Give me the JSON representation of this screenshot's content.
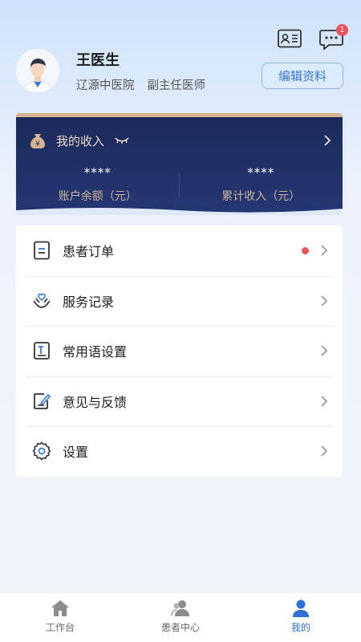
{
  "header": {
    "message_badge": "1"
  },
  "profile": {
    "name": "王医生",
    "hospital": "辽源中医院",
    "title": "副主任医师",
    "edit_label": "编辑资料"
  },
  "income": {
    "title": "我的收入",
    "balance_value": "****",
    "balance_label": "账户余额（元）",
    "total_value": "****",
    "total_label": "累计收入（元）"
  },
  "menu": {
    "items": [
      {
        "label": "患者订单",
        "icon": "document-icon",
        "has_dot": true
      },
      {
        "label": "服务记录",
        "icon": "hands-heart-icon"
      },
      {
        "label": "常用语设置",
        "icon": "text-template-icon"
      },
      {
        "label": "意见与反馈",
        "icon": "feedback-edit-icon"
      },
      {
        "label": "设置",
        "icon": "gear-icon"
      }
    ]
  },
  "tabbar": {
    "tabs": [
      {
        "label": "工作台",
        "icon": "home-icon"
      },
      {
        "label": "患者中心",
        "icon": "patients-icon"
      },
      {
        "label": "我的",
        "icon": "person-icon",
        "active": true
      }
    ]
  },
  "colors": {
    "accent": "#2f6fd6",
    "income_bg": "#1f2d61",
    "gold": "#d7b38f",
    "alert": "#f0525b"
  }
}
